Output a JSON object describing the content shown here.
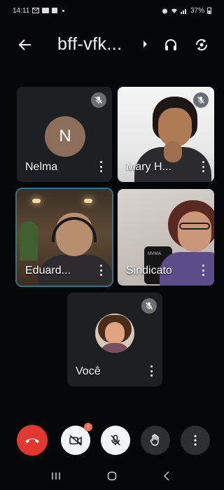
{
  "status_bar": {
    "time": "14:11",
    "battery": "37%"
  },
  "appbar": {
    "title": "bff-vfk...",
    "icons": [
      "back-arrow-icon",
      "caret-right-icon",
      "headphones-icon",
      "switch-camera-icon"
    ]
  },
  "participants": [
    {
      "name": "Nelma",
      "avatar_initial": "N",
      "avatar_color": "#8d6e5a",
      "muted": true,
      "video": false
    },
    {
      "name": "Mary H...",
      "muted": true,
      "video": true
    },
    {
      "name": "Eduard...",
      "muted": false,
      "video": true,
      "speaking": true
    },
    {
      "name": "Sindicato",
      "muted": false,
      "video": true
    },
    {
      "name": "Você",
      "muted": true,
      "video": false,
      "is_self": true
    }
  ],
  "sindicato_chair_label": "MVMA",
  "controls": {
    "camera_badge": "!",
    "items": [
      "end-call",
      "camera-off",
      "mic-off",
      "raise-hand",
      "more-options"
    ]
  },
  "colors": {
    "end_call": "#e2382f",
    "speaking_outline": "#3a7286",
    "muted_badge": "#6b6e73",
    "tile_bg": "#1e1f22"
  }
}
